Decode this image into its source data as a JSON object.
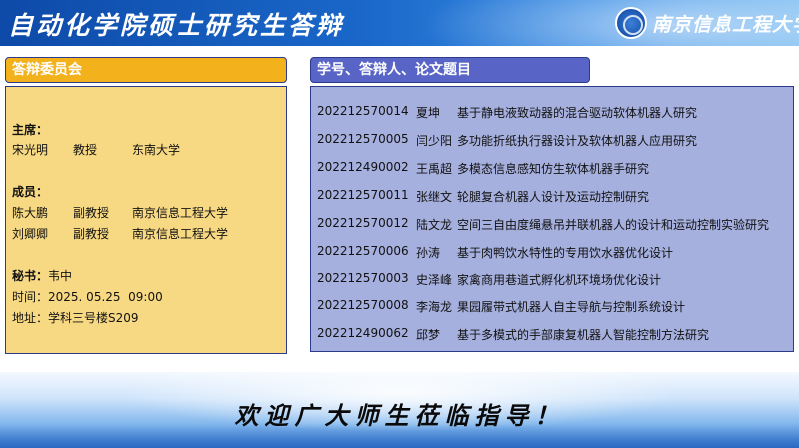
{
  "header": {
    "title": "自动化学院硕士研究生答辩",
    "university": "南京信息工程大学"
  },
  "committee_tab": "答辩委员会",
  "thesis_tab": "学号、答辩人、论文题目",
  "committee": {
    "chair_label": "主席：",
    "chair": {
      "name": "宋光明",
      "rank": "教授",
      "org": "东南大学"
    },
    "members_label": "成员：",
    "members": [
      {
        "name": "陈大鹏",
        "rank": "副教授",
        "org": "南京信息工程大学"
      },
      {
        "name": "刘卿卿",
        "rank": "副教授",
        "org": "南京信息工程大学"
      }
    ],
    "secretary_label": "秘书：",
    "secretary": "韦中",
    "time_label": "时间：",
    "time": "2025. 05.25  09:00",
    "place_label": "地址：",
    "place": "学科三号楼S209"
  },
  "theses": [
    {
      "id": "202212570014",
      "name": "夏坤",
      "title": "基于静电液致动器的混合驱动软体机器人研究"
    },
    {
      "id": "202212570005",
      "name": "闫少阳",
      "title": "多功能折纸执行器设计及软体机器人应用研究"
    },
    {
      "id": "202212490002",
      "name": "王禹超",
      "title": "多模态信息感知仿生软体机器手研究"
    },
    {
      "id": "202212570011",
      "name": "张继文",
      "title": "轮腿复合机器人设计及运动控制研究"
    },
    {
      "id": "202212570012",
      "name": "陆文龙",
      "title": "空间三自由度绳悬吊并联机器人的设计和运动控制实验研究"
    },
    {
      "id": "202212570006",
      "name": "孙涛",
      "title": "基于肉鸭饮水特性的专用饮水器优化设计"
    },
    {
      "id": "202212570003",
      "name": "史泽峰",
      "title": "家禽商用巷道式孵化机环境场优化设计"
    },
    {
      "id": "202212570008",
      "name": "李海龙",
      "title": "果园履带式机器人自主导航与控制系统设计"
    },
    {
      "id": "202212490062",
      "name": "邱梦",
      "title": "基于多模式的手部康复机器人智能控制方法研究"
    }
  ],
  "slogan": "欢迎广大师生莅临指导！",
  "colors": {
    "header_blue": "#1967c9",
    "committee_tab": "#f3b11c",
    "committee_panel": "#f8d983",
    "thesis_tab": "#5965c6",
    "thesis_panel": "#a6b0de"
  }
}
